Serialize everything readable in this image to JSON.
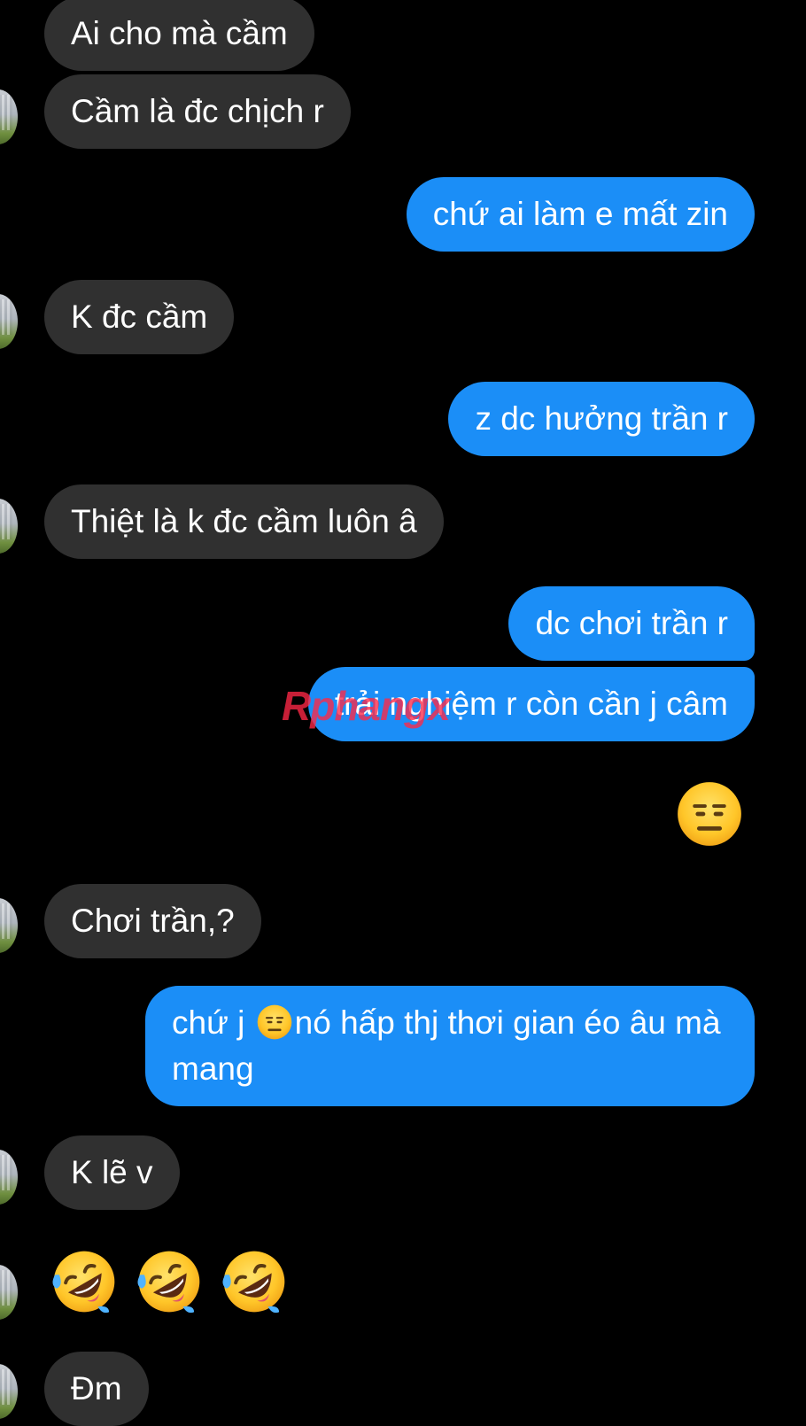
{
  "messages": [
    {
      "side": "in",
      "text": "Ai cho mà cầm"
    },
    {
      "side": "in",
      "text": "Cầm là đc chịch r"
    },
    {
      "side": "out",
      "text": "chứ ai làm e mất zin"
    },
    {
      "side": "in",
      "text": "K đc cầm"
    },
    {
      "side": "out",
      "text": "z dc hưởng trần r"
    },
    {
      "side": "in",
      "text": "Thiệt là k đc cầm luôn â"
    },
    {
      "side": "out",
      "text": "dc chơi trần r"
    },
    {
      "side": "out",
      "text": "trải nghiệm r còn cần j câm"
    },
    {
      "side": "out",
      "emoji": "expressionless-face"
    },
    {
      "side": "in",
      "text": "Chơi trần,?"
    },
    {
      "side": "out",
      "text_before": "chứ j ",
      "emoji": "expressionless-face",
      "text_after": "nó hấp thj thơi gian éo âu mà mang"
    },
    {
      "side": "in",
      "text": "K lẽ v"
    },
    {
      "side": "in",
      "emoji": "rolling-on-floor-laughing x3"
    },
    {
      "side": "in",
      "text": "Đm"
    }
  ],
  "watermark": "Rphangx",
  "colors": {
    "background": "#000000",
    "incoming_bubble": "#303030",
    "outgoing_bubble": "#1b8ef7",
    "text": "#ffffff"
  }
}
